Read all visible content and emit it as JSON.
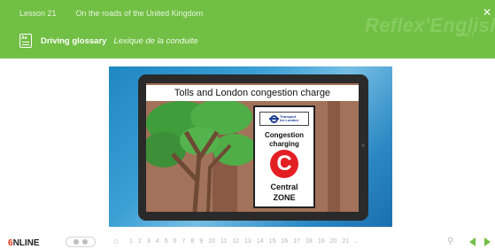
{
  "header": {
    "lesson": "Lesson 21",
    "lesson_title": "On the roads of the United Kingdom",
    "brand": "Reflex'English",
    "brand_sub": "Level 1",
    "close_icon": "close-icon",
    "glossary_title": "Driving glossary",
    "glossary_subtitle": "Lexique de la conduite",
    "glossary_icon": "glossary-book-icon"
  },
  "illustration": {
    "screen_title": "Tolls and London congestion charge",
    "sign": {
      "operator_line1": "Transport",
      "operator_line2": "for London",
      "line1": "Congestion",
      "line2": "charging",
      "symbol": "C",
      "line3": "Central",
      "line4": "ZONE"
    }
  },
  "footer": {
    "logo_number": "6",
    "logo_text": "NLINE",
    "home_icon": "home-icon",
    "pages": [
      "1",
      "2",
      "3",
      "4",
      "5",
      "6",
      "7",
      "8",
      "9",
      "10",
      "11",
      "12",
      "13",
      "14",
      "15",
      "16",
      "17",
      "18",
      "19",
      "20",
      "21"
    ],
    "ellipsis": "..",
    "search_icon": "search-icon",
    "prev_icon": "prev-arrow-icon",
    "next_icon": "next-arrow-icon"
  },
  "colors": {
    "header_bg": "#71bf44",
    "accent_red": "#e31e24",
    "nav_green": "#74c045"
  }
}
